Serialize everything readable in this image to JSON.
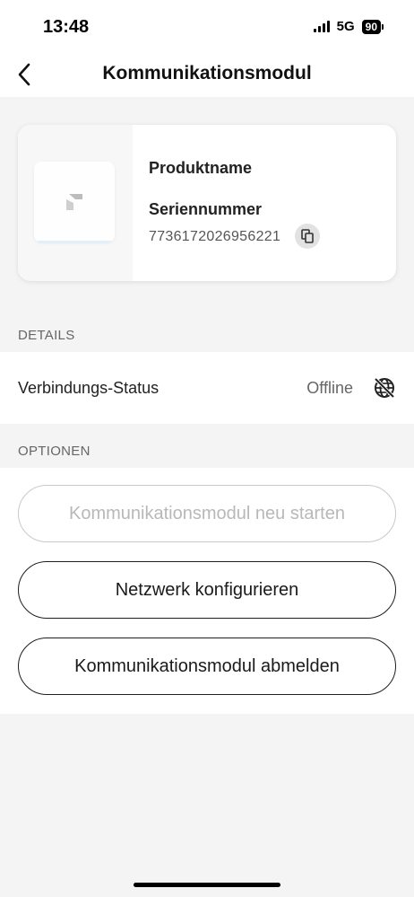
{
  "status_bar": {
    "time": "13:48",
    "network": "5G",
    "battery": "90"
  },
  "header": {
    "title": "Kommunikationsmodul",
    "back_icon": "chevron-left-icon"
  },
  "product": {
    "name_label": "Produktname",
    "serial_label": "Seriennummer",
    "serial_number": "7736172026956221",
    "copy_icon": "copy-icon"
  },
  "details": {
    "section_title": "DETAILS",
    "status_label": "Verbindungs-Status",
    "status_value": "Offline",
    "status_icon": "globe-offline-icon"
  },
  "options": {
    "section_title": "OPTIONEN",
    "buttons": [
      {
        "label": "Kommunikationsmodul neu starten",
        "enabled": false
      },
      {
        "label": "Netzwerk konfigurieren",
        "enabled": true
      },
      {
        "label": "Kommunikationsmodul abmelden",
        "enabled": true
      }
    ]
  },
  "colors": {
    "background": "#f4f4f4",
    "surface": "#ffffff",
    "text_primary": "#1a1a1a",
    "text_secondary": "#666666",
    "disabled": "#b8b8b8"
  }
}
